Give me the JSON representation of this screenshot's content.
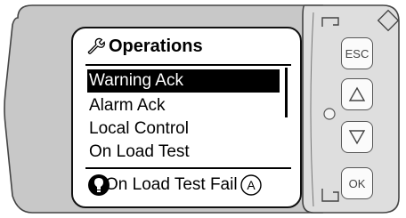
{
  "screen": {
    "title": "Operations",
    "title_icon": "wrench-icon",
    "menu_items": [
      {
        "label": "Warning Ack",
        "selected": true
      },
      {
        "label": "Alarm Ack",
        "selected": false
      },
      {
        "label": "Local Control",
        "selected": false
      },
      {
        "label": "On Load Test",
        "selected": false
      }
    ],
    "status_text": "On Load Test Fail",
    "status_icons": [
      "lightbulb-icon",
      "auto-mode-icon"
    ]
  },
  "keypad": {
    "esc_label": "ESC",
    "up_icon": "up-arrow-icon",
    "down_icon": "down-arrow-icon",
    "ok_label": "OK",
    "led_icon": "status-led-icon"
  },
  "colors": {
    "housing": "#c8c8c8",
    "keypad_panel": "#dedede",
    "selection": "#000000"
  }
}
